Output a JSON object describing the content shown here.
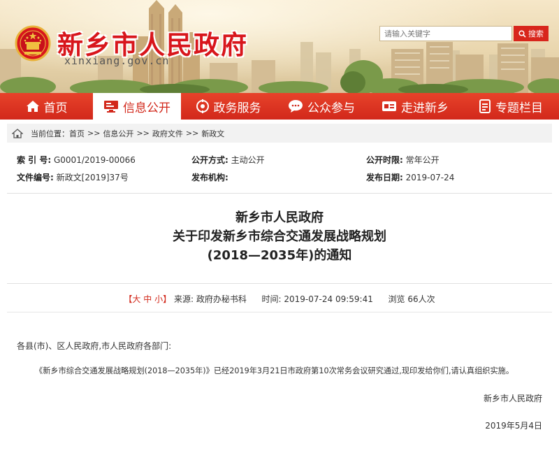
{
  "header": {
    "site_title": "新乡市人民政府",
    "site_domain": "xinxiang.gov.cn",
    "search": {
      "placeholder": "请输入关键字",
      "button_label": "搜索"
    }
  },
  "nav": {
    "items": [
      {
        "label": "首页",
        "icon": "home-icon"
      },
      {
        "label": "信息公开",
        "icon": "monitor-icon",
        "active": true
      },
      {
        "label": "政务服务",
        "icon": "service-icon"
      },
      {
        "label": "公众参与",
        "icon": "chat-icon"
      },
      {
        "label": "走进新乡",
        "icon": "card-icon"
      },
      {
        "label": "专题栏目",
        "icon": "document-icon"
      }
    ]
  },
  "breadcrumb": {
    "prefix": "当前位置：",
    "items": [
      "首页",
      "信息公开",
      "政府文件",
      "新政文"
    ],
    "separator": ">>"
  },
  "meta": {
    "index_no_label": "索 引 号:",
    "index_no_value": "G0001/2019-00066",
    "open_method_label": "公开方式:",
    "open_method_value": "主动公开",
    "open_period_label": "公开时限:",
    "open_period_value": "常年公开",
    "doc_no_label": "文件编号:",
    "doc_no_value": "新政文[2019]37号",
    "issuer_label": "发布机构:",
    "issuer_value": "",
    "publish_date_label": "发布日期:",
    "publish_date_value": "2019-07-24"
  },
  "document": {
    "title_line1": "新乡市人民政府",
    "title_line2": "关于印发新乡市综合交通发展战略规划",
    "title_line3": "(2018—2035年)的通知",
    "font_size_prefix": "【",
    "font_size_large": "大",
    "font_size_medium": "中",
    "font_size_small": "小",
    "font_size_suffix": "】",
    "source_label": "来源:",
    "source_value": "政府办秘书科",
    "time_label": "时间:",
    "time_value": "2019-07-24 09:59:41",
    "views": "浏览 66人次",
    "salutation": "各县(市)、区人民政府,市人民政府各部门:",
    "paragraph": "《新乡市综合交通发展战略规划(2018—2035年)》已经2019年3月21日市政府第10次常务会议研究通过,现印发给你们,请认真组织实施。",
    "signer": "新乡市人民政府",
    "sign_date": "2019年5月4日"
  },
  "colors": {
    "brand_red": "#d8161c",
    "nav_red": "#d2281b",
    "breadcrumb_bg": "#f2f2f2"
  }
}
